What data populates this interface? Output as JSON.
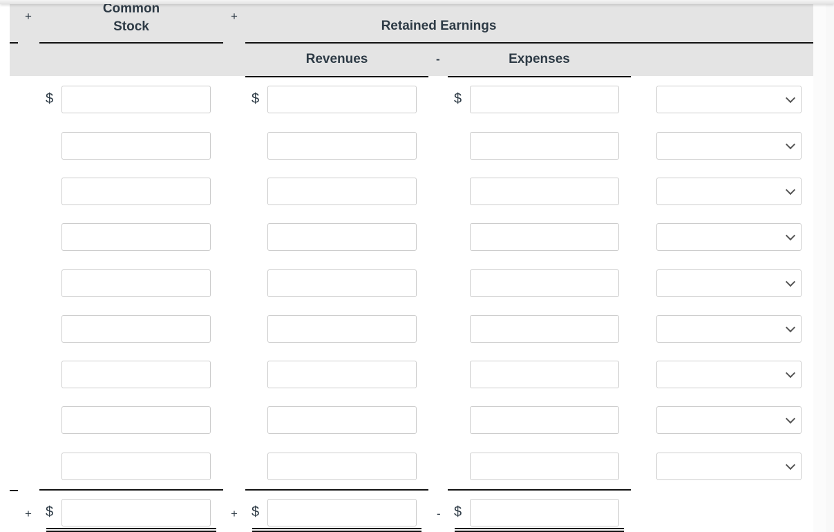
{
  "header": {
    "common_stock_line1": "Common",
    "common_stock_line2": "Stock",
    "retained_earnings": "Retained Earnings",
    "revenues": "Revenues",
    "expenses": "Expenses",
    "op_plus_1": "+",
    "op_plus_2": "+",
    "op_minus": "-"
  },
  "currency_symbol": "$",
  "rows": [
    {
      "common_stock": "",
      "revenues": "",
      "expenses": "",
      "account": ""
    },
    {
      "common_stock": "",
      "revenues": "",
      "expenses": "",
      "account": ""
    },
    {
      "common_stock": "",
      "revenues": "",
      "expenses": "",
      "account": ""
    },
    {
      "common_stock": "",
      "revenues": "",
      "expenses": "",
      "account": ""
    },
    {
      "common_stock": "",
      "revenues": "",
      "expenses": "",
      "account": ""
    },
    {
      "common_stock": "",
      "revenues": "",
      "expenses": "",
      "account": ""
    },
    {
      "common_stock": "",
      "revenues": "",
      "expenses": "",
      "account": ""
    },
    {
      "common_stock": "",
      "revenues": "",
      "expenses": "",
      "account": ""
    },
    {
      "common_stock": "",
      "revenues": "",
      "expenses": "",
      "account": ""
    }
  ],
  "totals": {
    "op_plus_1": "+",
    "op_plus_2": "+",
    "op_minus": "-",
    "common_stock": "",
    "revenues": "",
    "expenses": ""
  }
}
